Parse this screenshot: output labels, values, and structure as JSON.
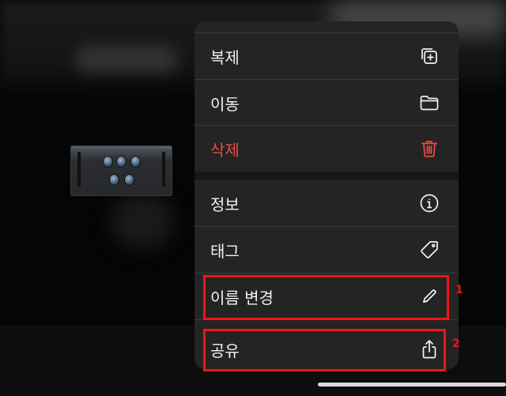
{
  "menu": {
    "items": [
      {
        "label": "복제",
        "icon": "duplicate-icon"
      },
      {
        "label": "이동",
        "icon": "folder-icon"
      },
      {
        "label": "삭제",
        "icon": "trash-icon",
        "color": "#ef4a3f"
      },
      {
        "label": "정보",
        "icon": "info-icon"
      },
      {
        "label": "태그",
        "icon": "tag-icon"
      },
      {
        "label": "이름 변경",
        "icon": "pencil-icon"
      },
      {
        "label": "공유",
        "icon": "share-icon"
      }
    ]
  },
  "annotations": [
    {
      "label": "1",
      "color": "#f0141b"
    },
    {
      "label": "2",
      "color": "#f0141b"
    }
  ]
}
